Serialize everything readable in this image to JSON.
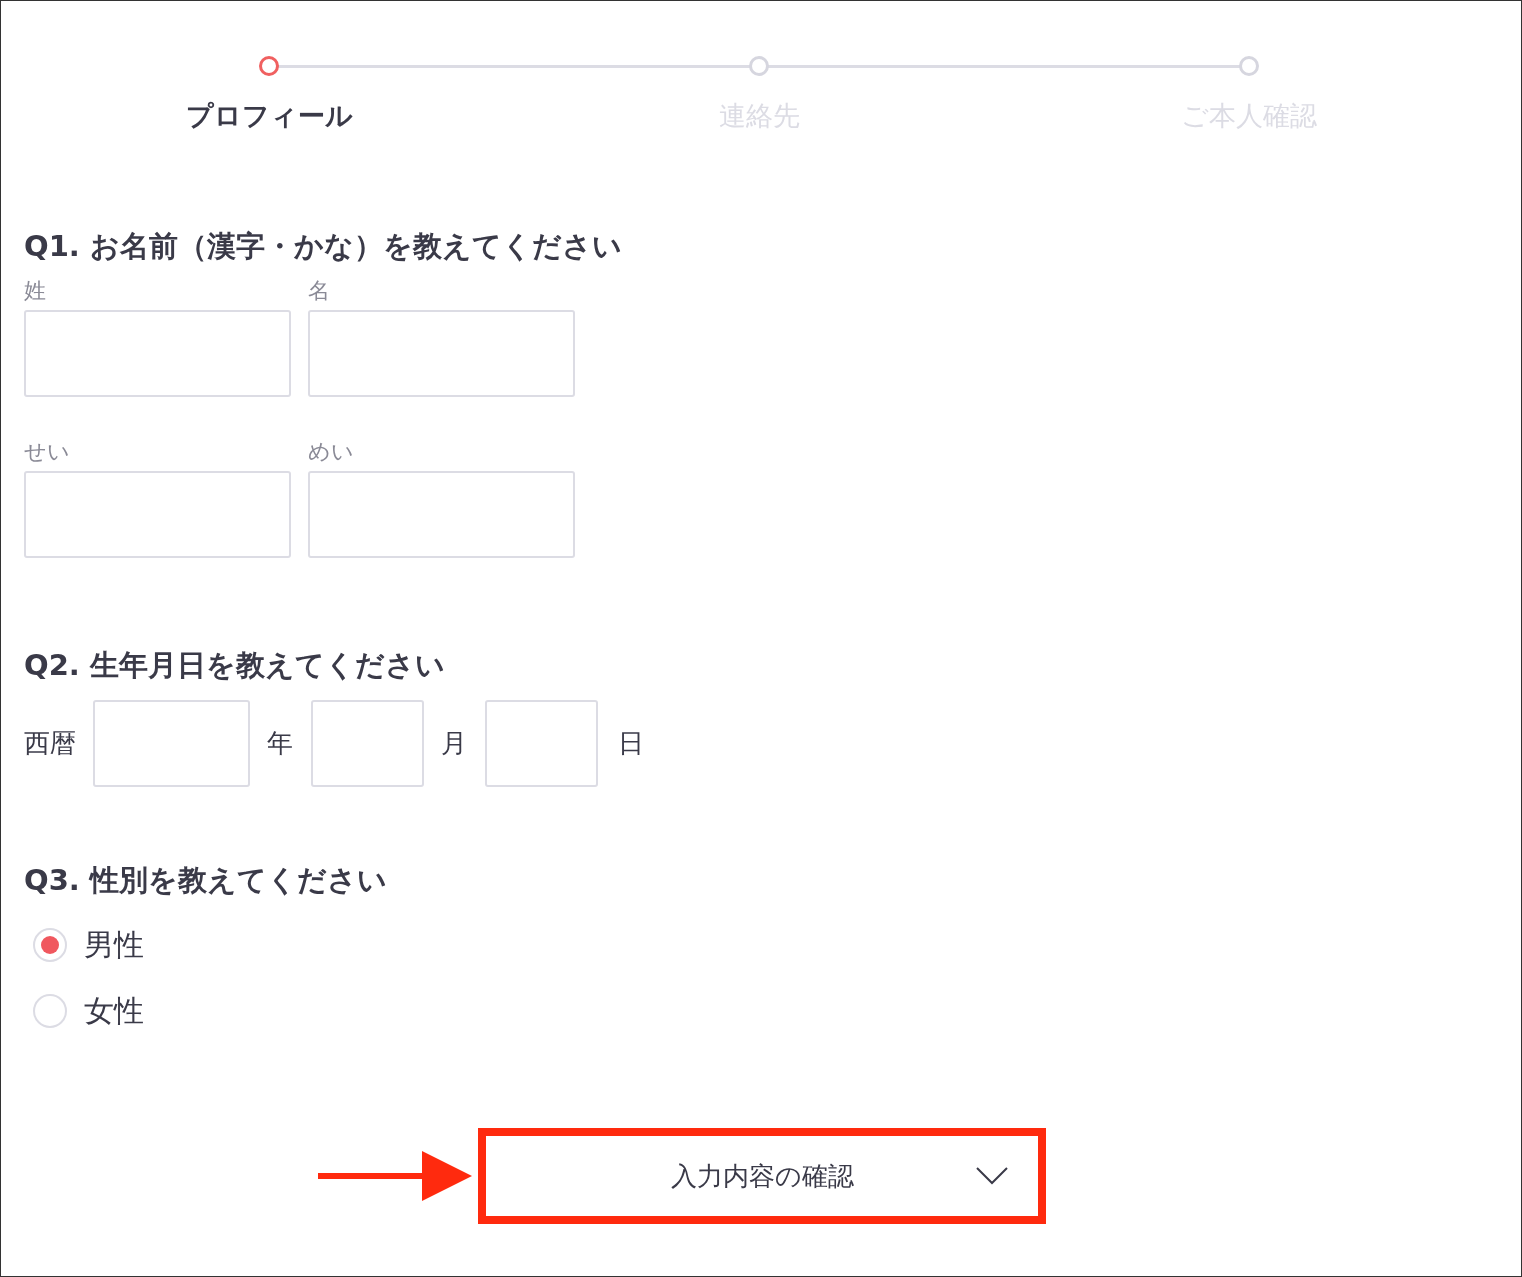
{
  "steps": [
    {
      "label": "プロフィール",
      "selected": true
    },
    {
      "label": "連絡先",
      "selected": false
    },
    {
      "label": "ご本人確認",
      "selected": false
    }
  ],
  "questions": [
    {
      "kind": "name",
      "title": "Q1. お名前（漢字・かな）を教えてください",
      "rows": [
        {
          "fields": [
            {
              "label": "姓"
            },
            {
              "label": "名"
            }
          ]
        },
        {
          "fields": [
            {
              "label": "せい"
            },
            {
              "label": "めい"
            }
          ]
        }
      ]
    },
    {
      "kind": "date",
      "title": "Q2. 生年月日を教えてください",
      "prefix": "西暦",
      "fields": [
        {
          "unit": "年"
        },
        {
          "unit": "月"
        },
        {
          "unit": "日"
        }
      ]
    },
    {
      "kind": "radio",
      "title": "Q3. 性別を教えてください",
      "options": [
        {
          "label": "男性",
          "selected": true
        },
        {
          "label": "女性",
          "selected": false
        }
      ]
    }
  ],
  "confirm_button": {
    "label": "入力内容の確認"
  }
}
